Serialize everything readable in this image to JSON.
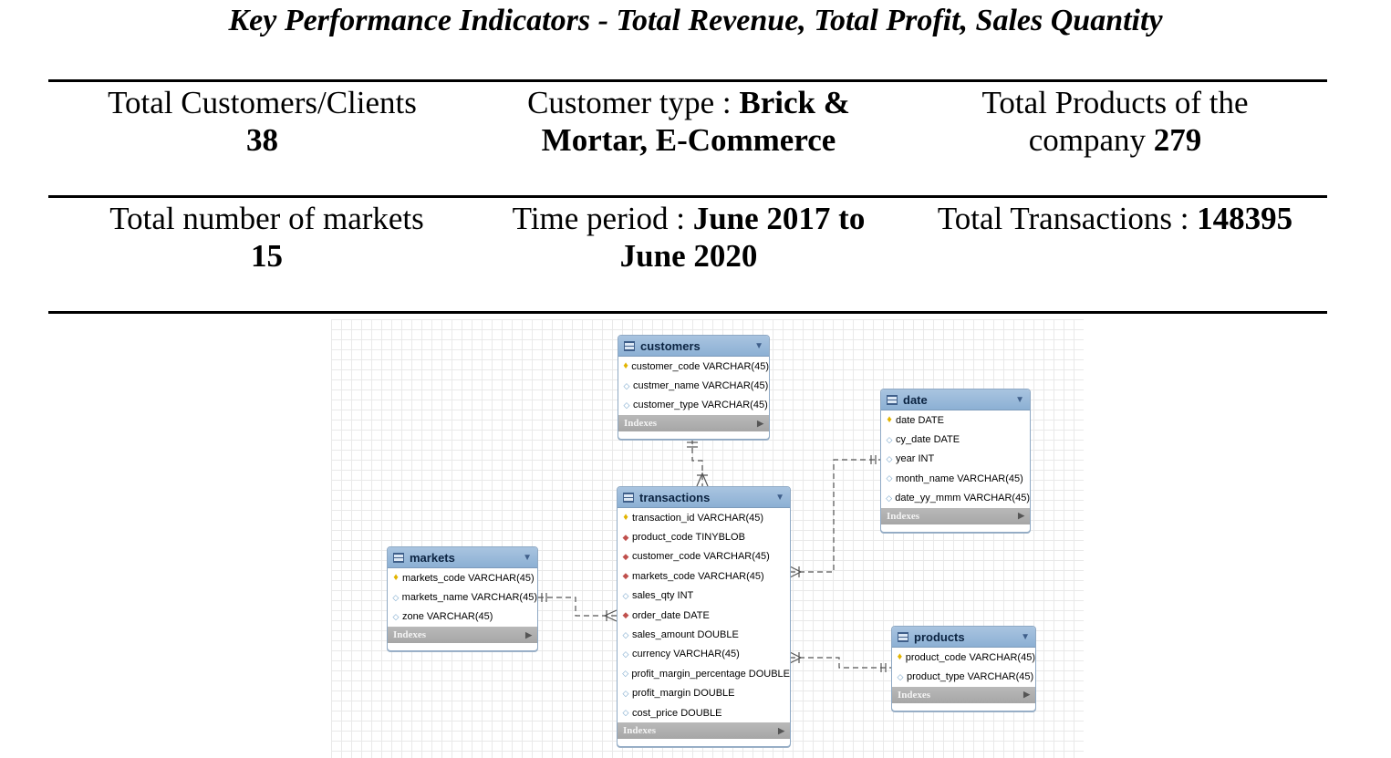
{
  "title": "Key Performance Indicators - Total Revenue, Total Profit, Sales Quantity",
  "kpis": {
    "customers": {
      "label": "Total Customers/Clients",
      "value": "38"
    },
    "customer_type": {
      "label": "Customer type : ",
      "value_line1": "Brick &",
      "value_line2": "Mortar, E-Commerce"
    },
    "products": {
      "label_line1": "Total Products of the",
      "label_line2": "company ",
      "value": "279"
    },
    "markets": {
      "label": "Total number of markets",
      "value": "15"
    },
    "time_period": {
      "label": "Time period : ",
      "value_line1": "June 2017 to",
      "value_line2": "June 2020"
    },
    "transactions": {
      "label": "Total Transactions : ",
      "value": "148395"
    }
  },
  "diagram": {
    "indexes_label": "Indexes",
    "customers": {
      "name": "customers",
      "columns": [
        {
          "icon": "primary-key-icon",
          "text": "customer_code VARCHAR(45)"
        },
        {
          "icon": "attribute-icon",
          "text": "custmer_name VARCHAR(45)"
        },
        {
          "icon": "attribute-icon",
          "text": "customer_type VARCHAR(45)"
        }
      ]
    },
    "date": {
      "name": "date",
      "columns": [
        {
          "icon": "primary-key-icon",
          "text": "date DATE"
        },
        {
          "icon": "attribute-icon",
          "text": "cy_date DATE"
        },
        {
          "icon": "attribute-icon",
          "text": "year INT"
        },
        {
          "icon": "attribute-icon",
          "text": "month_name VARCHAR(45)"
        },
        {
          "icon": "attribute-icon",
          "text": "date_yy_mmm VARCHAR(45)"
        }
      ]
    },
    "transactions": {
      "name": "transactions",
      "columns": [
        {
          "icon": "primary-key-icon",
          "text": "transaction_id VARCHAR(45)"
        },
        {
          "icon": "foreign-key-icon",
          "text": "product_code TINYBLOB"
        },
        {
          "icon": "foreign-key-icon",
          "text": "customer_code VARCHAR(45)"
        },
        {
          "icon": "foreign-key-icon",
          "text": "markets_code VARCHAR(45)"
        },
        {
          "icon": "attribute-icon",
          "text": "sales_qty INT"
        },
        {
          "icon": "foreign-key-icon",
          "text": "order_date DATE"
        },
        {
          "icon": "attribute-icon",
          "text": "sales_amount DOUBLE"
        },
        {
          "icon": "attribute-icon",
          "text": "currency VARCHAR(45)"
        },
        {
          "icon": "attribute-icon",
          "text": "profit_margin_percentage DOUBLE"
        },
        {
          "icon": "attribute-icon",
          "text": "profit_margin DOUBLE"
        },
        {
          "icon": "attribute-icon",
          "text": "cost_price DOUBLE"
        }
      ]
    },
    "markets": {
      "name": "markets",
      "columns": [
        {
          "icon": "primary-key-icon",
          "text": "markets_code VARCHAR(45)"
        },
        {
          "icon": "attribute-icon",
          "text": "markets_name VARCHAR(45)"
        },
        {
          "icon": "attribute-icon",
          "text": "zone VARCHAR(45)"
        }
      ]
    },
    "products": {
      "name": "products",
      "columns": [
        {
          "icon": "primary-key-icon",
          "text": "product_code VARCHAR(45)"
        },
        {
          "icon": "attribute-icon",
          "text": "product_type VARCHAR(45)"
        }
      ]
    }
  }
}
